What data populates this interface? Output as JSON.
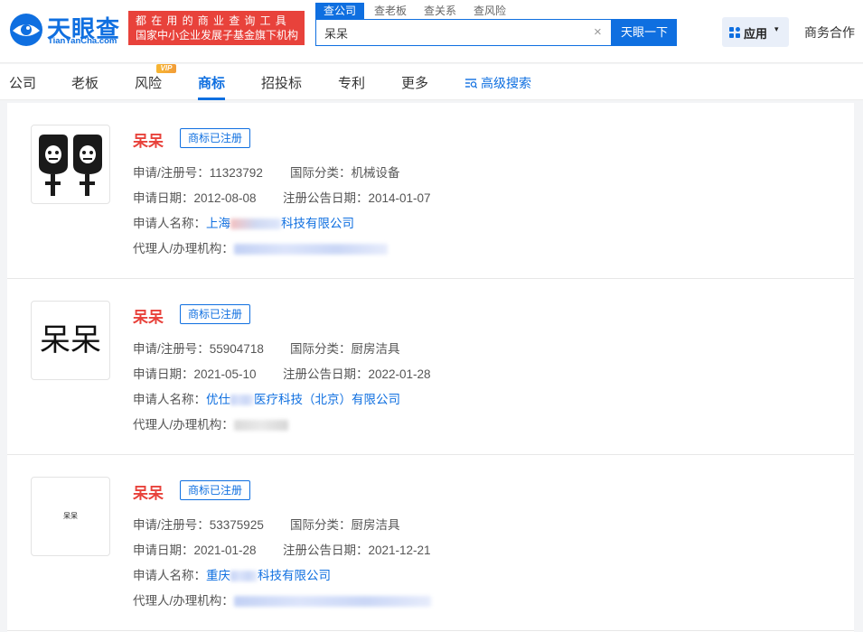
{
  "header": {
    "logo_text": "天眼查",
    "logo_sub": "TianYanCha.com",
    "slogan_line1": "都在用的商业查询工具",
    "slogan_line2": "国家中小企业发展子基金旗下机构",
    "search_tabs": [
      "查公司",
      "查老板",
      "查关系",
      "查风险"
    ],
    "search_value": "呆呆",
    "search_clear": "×",
    "search_button": "天眼一下",
    "apps_label": "应用",
    "apps_caret": "▾",
    "biz_link": "商务合作"
  },
  "nav": {
    "items": [
      "公司",
      "老板",
      "风险",
      "商标",
      "招投标",
      "专利",
      "更多"
    ],
    "active_index": 3,
    "vip_badge": "VIP",
    "advanced_search": "高级搜索"
  },
  "labels": {
    "reg_no": "申请/注册号：",
    "intl_class": "国际分类：",
    "apply_date": "申请日期：",
    "notice_date": "注册公告日期：",
    "applicant": "申请人名称：",
    "agent": "代理人/办理机构："
  },
  "colors": {
    "brand_blue": "#0f6fe0",
    "accent_red": "#e8423b"
  },
  "results": [
    {
      "name": "呆呆",
      "status": "商标已注册",
      "reg_no": "11323792",
      "intl_class": "机械设备",
      "apply_date": "2012-08-08",
      "notice_date": "2014-01-07",
      "applicant_prefix": "上海",
      "applicant_suffix": "科技有限公司",
      "thumb": "graphic-figures"
    },
    {
      "name": "呆呆",
      "status": "商标已注册",
      "reg_no": "55904718",
      "intl_class": "厨房洁具",
      "apply_date": "2021-05-10",
      "notice_date": "2022-01-28",
      "applicant_prefix": "优仕",
      "applicant_suffix": "医疗科技（北京）有限公司",
      "thumb_text": "呆呆"
    },
    {
      "name": "呆呆",
      "status": "商标已注册",
      "reg_no": "53375925",
      "intl_class": "厨房洁具",
      "apply_date": "2021-01-28",
      "notice_date": "2021-12-21",
      "applicant_prefix": "重庆",
      "applicant_suffix": "科技有限公司",
      "thumb_text": "呆呆"
    }
  ]
}
